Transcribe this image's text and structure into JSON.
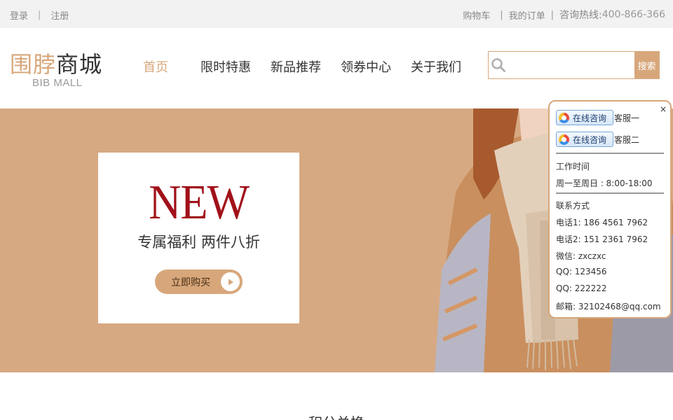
{
  "topbar": {
    "login": "登录",
    "separator": "|",
    "register": "注册",
    "cart": "购物车",
    "orders": "我的订单",
    "hotline_label": "咨询热线:",
    "hotline_number": "400-866-366"
  },
  "header": {
    "logo_part1": "围脖",
    "logo_part2": "商城",
    "logo_sub": "BIB MALL",
    "nav": [
      "首页",
      "限时特惠",
      "新品推荐",
      "领券中心",
      "关于我们"
    ],
    "search_placeholder": "",
    "search_button": "搜索"
  },
  "banner": {
    "new_text": "NEW",
    "tagline": "专属福利 两件八折",
    "buy_button": "立即购买"
  },
  "service_panel": {
    "close": "×",
    "chat_button": "在线咨询",
    "agent1": "客服一",
    "agent2": "客服二",
    "work_time_title": "工作时间",
    "work_time": "周一至周日 : 8:00-18:00",
    "contact_title": "联系方式",
    "phone1": "电话1:  186 4561 7962",
    "phone2": "电话2:  151 2361 7962",
    "wechat": "微信:  zxczxc",
    "qq1": "QQ:  123456",
    "qq2": "QQ:  222222",
    "email": "邮箱: 32102468@qq.com"
  },
  "section": {
    "title": "积分兑换"
  },
  "colors": {
    "accent": "#d7a77b",
    "banner_bg": "#d7a982",
    "new_text": "#a1111a"
  }
}
